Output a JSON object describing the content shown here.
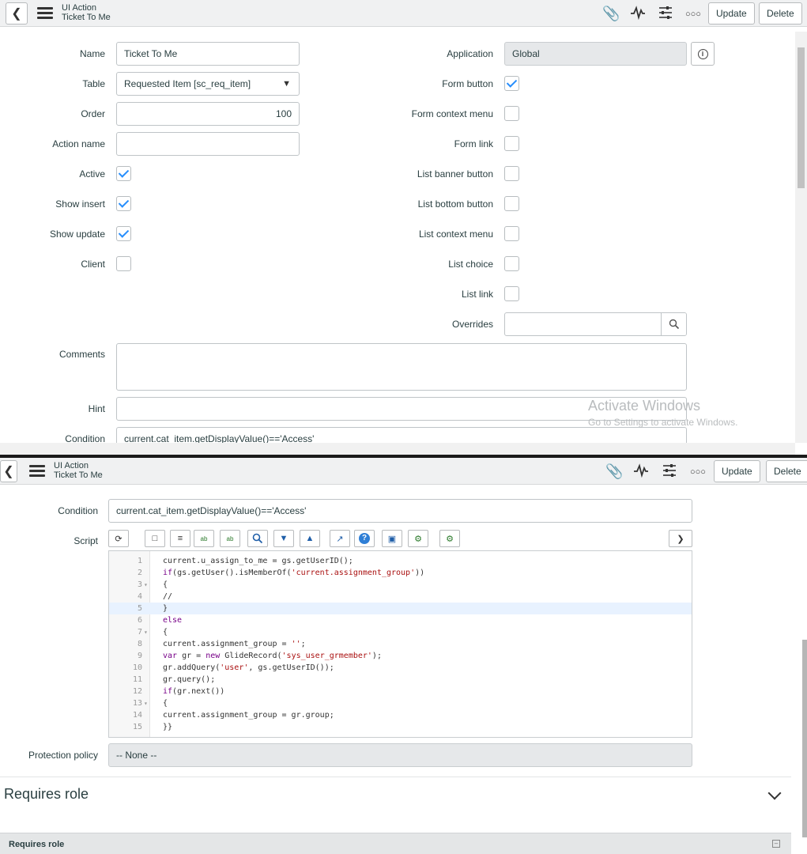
{
  "header": {
    "record_type": "UI Action",
    "record_name": "Ticket To Me",
    "update_label": "Update",
    "delete_label": "Delete"
  },
  "form": {
    "name_label": "Name",
    "name_value": "Ticket To Me",
    "table_label": "Table",
    "table_value": "Requested Item [sc_req_item]",
    "order_label": "Order",
    "order_value": "100",
    "action_name_label": "Action name",
    "action_name_value": "",
    "active_label": "Active",
    "active": true,
    "show_insert_label": "Show insert",
    "show_insert": true,
    "show_update_label": "Show update",
    "show_update": true,
    "client_label": "Client",
    "client": false,
    "application_label": "Application",
    "application_value": "Global",
    "form_button_label": "Form button",
    "form_button": true,
    "form_context_menu_label": "Form context menu",
    "form_context_menu": false,
    "form_link_label": "Form link",
    "form_link": false,
    "list_banner_button_label": "List banner button",
    "list_banner_button": false,
    "list_bottom_button_label": "List bottom button",
    "list_bottom_button": false,
    "list_context_menu_label": "List context menu",
    "list_context_menu": false,
    "list_choice_label": "List choice",
    "list_choice": false,
    "list_link_label": "List link",
    "list_link": false,
    "overrides_label": "Overrides",
    "overrides_value": "",
    "comments_label": "Comments",
    "comments_value": "",
    "hint_label": "Hint",
    "hint_value": "",
    "condition_label": "Condition",
    "condition_value": "current.cat_item.getDisplayValue()=='Access'",
    "script_label": "Script",
    "protection_policy_label": "Protection policy",
    "protection_policy_value": "-- None --"
  },
  "script_lines": [
    {
      "n": "1",
      "fold": "",
      "text": "current.u_assign_to_me = gs.getUserID();"
    },
    {
      "n": "2",
      "fold": "",
      "text": "if(gs.getUser().isMemberOf('current.assignment_group'))"
    },
    {
      "n": "3",
      "fold": "▾",
      "text": "{"
    },
    {
      "n": "4",
      "fold": "",
      "text": "//"
    },
    {
      "n": "5",
      "fold": "",
      "text": "}"
    },
    {
      "n": "6",
      "fold": "",
      "text": "else"
    },
    {
      "n": "7",
      "fold": "▾",
      "text": "{"
    },
    {
      "n": "8",
      "fold": "",
      "text": "current.assignment_group = '';"
    },
    {
      "n": "9",
      "fold": "",
      "text": "var gr = new GlideRecord('sys_user_grmember');"
    },
    {
      "n": "10",
      "fold": "",
      "text": "gr.addQuery('user', gs.getUserID());"
    },
    {
      "n": "11",
      "fold": "",
      "text": "gr.query();"
    },
    {
      "n": "12",
      "fold": "",
      "text": "if(gr.next())"
    },
    {
      "n": "13",
      "fold": "▾",
      "text": "{"
    },
    {
      "n": "14",
      "fold": "",
      "text": "current.assignment_group = gr.group;"
    },
    {
      "n": "15",
      "fold": "",
      "text": "}}"
    }
  ],
  "related": {
    "section_title": "Requires role",
    "list_title": "Requires role"
  },
  "watermark": {
    "line1": "Activate Windows",
    "line2": "Go to Settings to activate Windows."
  }
}
